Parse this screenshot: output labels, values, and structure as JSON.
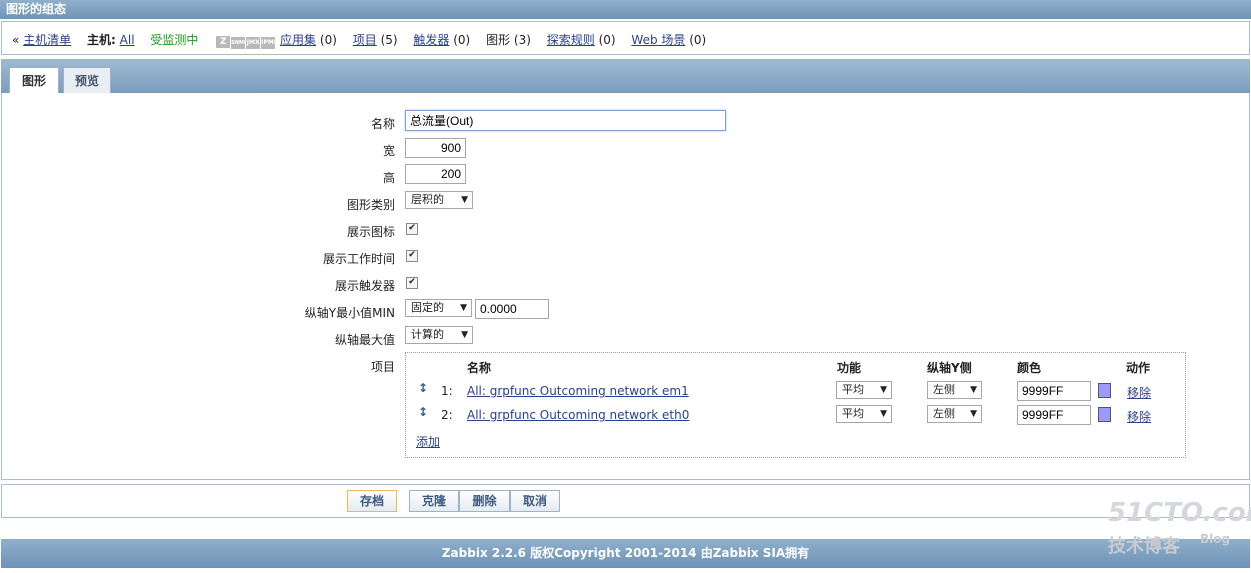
{
  "window": {
    "title": "图形的组态"
  },
  "nav": {
    "back_arrow": "«",
    "host_list": "主机清单",
    "host_label": "主机:",
    "host_value": "All",
    "monitored": "受监测中",
    "app_sets": "应用集",
    "app_sets_count": "(0)",
    "items": "项目",
    "items_count": "(5)",
    "triggers": "触发器",
    "triggers_count": "(0)",
    "graphs": "图形",
    "graphs_count": "(3)",
    "discovery": "探索规则",
    "discovery_count": "(0)",
    "web": "Web 场景",
    "web_count": "(0)",
    "availability_icons": [
      "Z",
      "SNMP",
      "JMX",
      "IPMI"
    ]
  },
  "tabs": [
    {
      "label": "图形"
    },
    {
      "label": "预览"
    }
  ],
  "form": {
    "name_label": "名称",
    "name_value": "总流量(Out)",
    "width_label": "宽",
    "width_value": "900",
    "height_label": "高",
    "height_value": "200",
    "graph_type_label": "图形类别",
    "graph_type_value": "层积的",
    "show_legend_label": "展示图标",
    "show_worktime_label": "展示工作时间",
    "show_triggers_label": "展示触发器",
    "ymin_label": "纵轴Y最小值MIN",
    "ymin_type": "固定的",
    "ymin_value": "0.0000",
    "ymax_label": "纵轴最大值",
    "ymax_type": "计算的",
    "items_label": "项目"
  },
  "items_table": {
    "headers": {
      "name": "名称",
      "function": "功能",
      "yaxis": "纵轴Y侧",
      "color": "颜色",
      "action": "动作"
    },
    "rows": [
      {
        "num": "1:",
        "name": "All: grpfunc Outcoming network em1",
        "function": "平均",
        "yaxis": "左侧",
        "color": "9999FF",
        "action": "移除"
      },
      {
        "num": "2:",
        "name": "All: grpfunc Outcoming network eth0",
        "function": "平均",
        "yaxis": "左侧",
        "color": "9999FF",
        "action": "移除"
      }
    ],
    "add": "添加"
  },
  "buttons": {
    "save": "存档",
    "clone": "克隆",
    "delete": "删除",
    "cancel": "取消"
  },
  "footer": {
    "text": "Zabbix 2.2.6 版权Copyright 2001-2014 由Zabbix SIA拥有"
  },
  "watermark": {
    "line1": "51CTO.com",
    "line2": "技术博客",
    "line3": "Blog"
  },
  "colors": {
    "accent": "#7a9dbd",
    "swatch": "#9999FF",
    "monitored": "#1a9a1a"
  }
}
